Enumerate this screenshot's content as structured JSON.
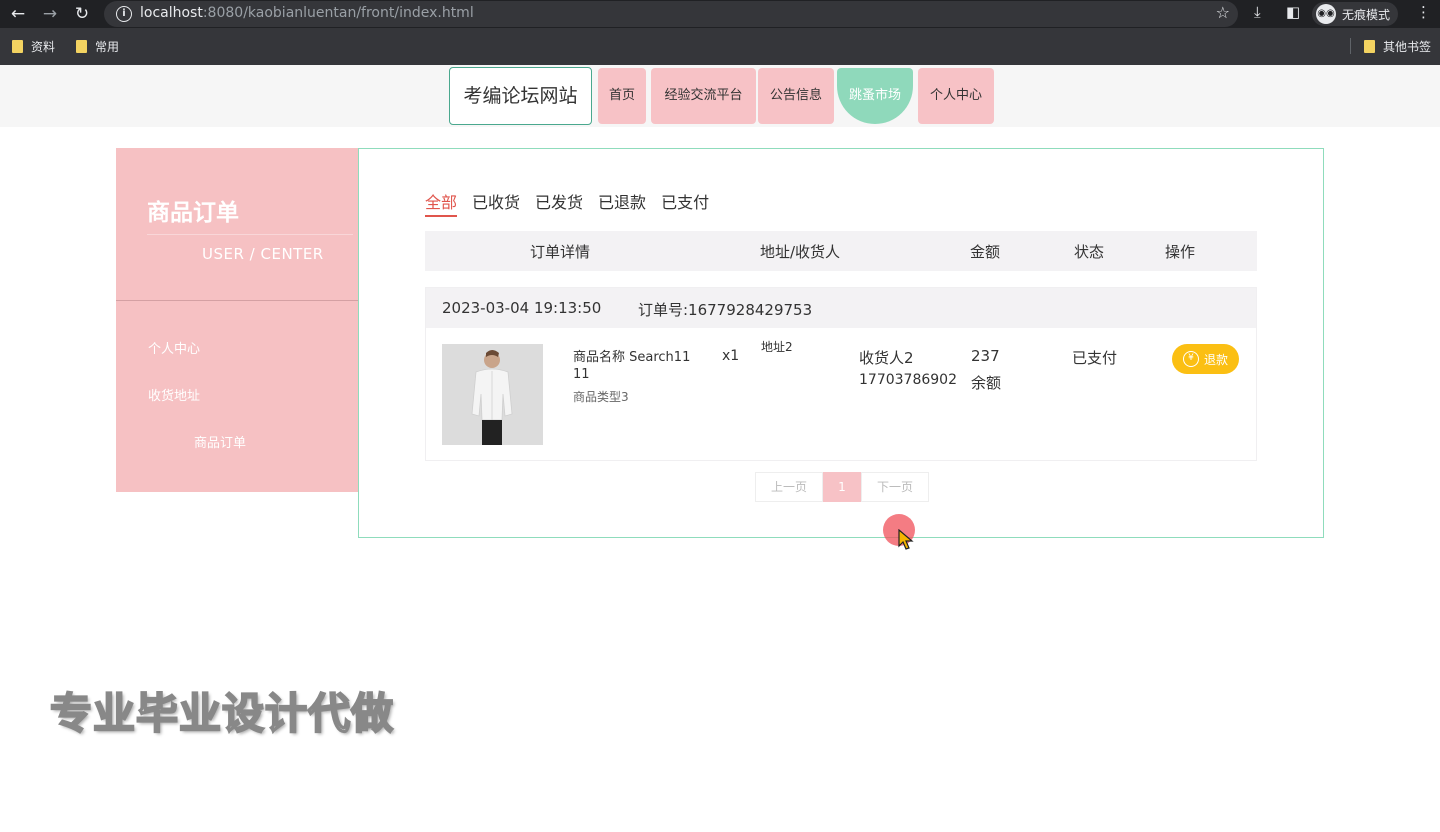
{
  "browser": {
    "url_host": "localhost",
    "url_rest": ":8080/kaobianluentan/front/index.html",
    "incognito_label": "无痕模式",
    "bookmarks": [
      "资料",
      "常用"
    ],
    "other_bookmarks": "其他书签"
  },
  "header": {
    "site_name": "考编论坛网站",
    "nav": [
      "首页",
      "经验交流平台",
      "公告信息",
      "跳蚤市场",
      "个人中心"
    ],
    "active_nav": "跳蚤市场"
  },
  "sidebar": {
    "title": "商品订单",
    "subtitle": "USER / CENTER",
    "items": [
      "个人中心",
      "收货地址",
      "商品订单"
    ]
  },
  "tabs": {
    "items": [
      "全部",
      "已收货",
      "已发货",
      "已退款",
      "已支付"
    ],
    "active": "全部"
  },
  "table": {
    "headers": [
      "订单详情",
      "地址/收货人",
      "金额",
      "状态",
      "操作"
    ]
  },
  "order": {
    "date": "2023-03-04 19:13:50",
    "order_no": "订单号:1677928429753",
    "product_name_line1": "商品名称 Search11",
    "product_name_line2": "11",
    "product_type": "商品类型3",
    "quantity": "x1",
    "address": "地址2",
    "receiver": "收货人2",
    "phone": "17703786902",
    "amount": "237",
    "pay_method": "余额",
    "status": "已支付",
    "action": "退款"
  },
  "pagination": {
    "prev": "上一页",
    "current": "1",
    "next": "下一页"
  },
  "watermark": "专业毕业设计代做",
  "colors": {
    "nav_pink": "#f7c2c6",
    "nav_active": "#8fd9bb",
    "sidebar_pink": "#f6c1c3",
    "panel_border": "#8fdcbc",
    "tab_active": "#e0554c",
    "refund_button": "#fbbf13"
  }
}
